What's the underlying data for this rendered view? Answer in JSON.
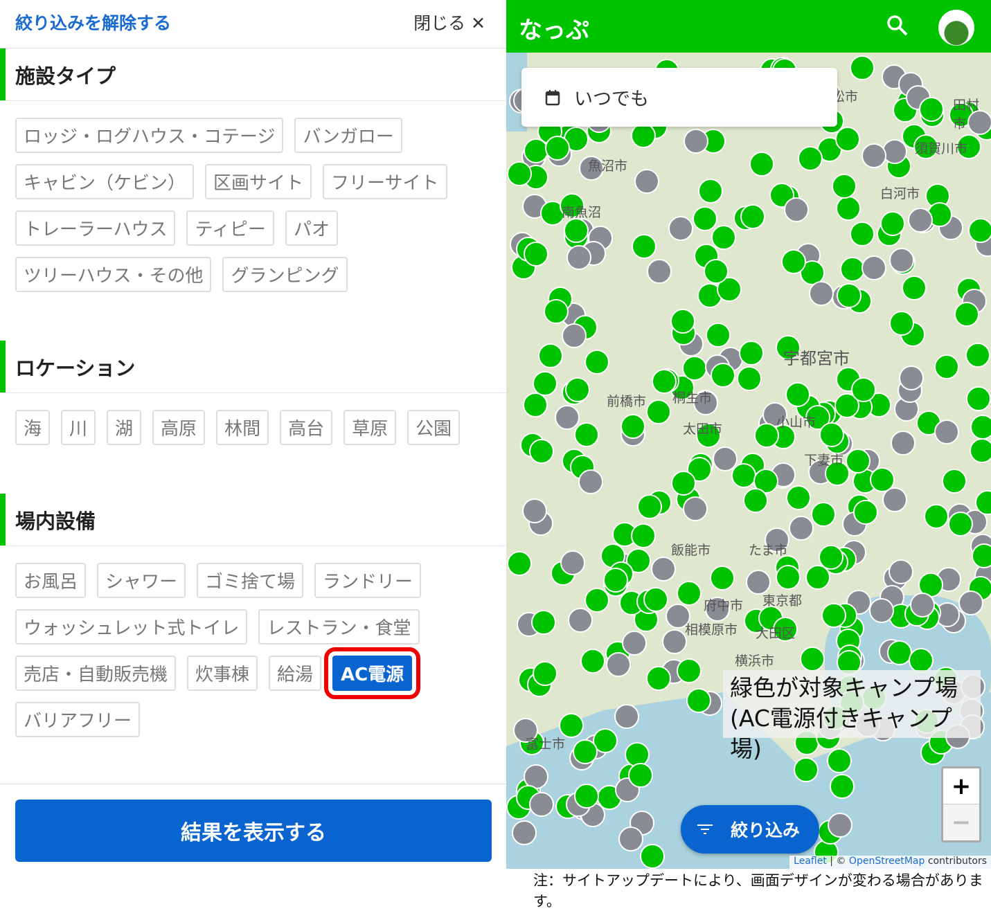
{
  "panel": {
    "clear_filter": "絞り込みを解除する",
    "close": "閉じる ✕",
    "sections": [
      {
        "title": "施設タイプ",
        "chips": [
          "ロッジ・ログハウス・コテージ",
          "バンガロー",
          "キャビン（ケビン）",
          "区画サイト",
          "フリーサイト",
          "トレーラーハウス",
          "ティピー",
          "パオ",
          "ツリーハウス・その他",
          "グランピング"
        ]
      },
      {
        "title": "ロケーション",
        "chips": [
          "海",
          "川",
          "湖",
          "高原",
          "林間",
          "高台",
          "草原",
          "公園"
        ]
      },
      {
        "title": "場内設備",
        "chips": [
          "お風呂",
          "シャワー",
          "ゴミ捨て場",
          "ランドリー",
          "ウォッシュレット式トイレ",
          "レストラン・食堂",
          "売店・自動販売機",
          "炊事棟",
          "給湯",
          "AC電源",
          "バリアフリー"
        ],
        "selected": "AC電源"
      }
    ],
    "show_results": "結果を表示する"
  },
  "map": {
    "app_title": "なっぷ",
    "date_filter": "いつでも",
    "filter_button": "絞り込み",
    "zoom_in": "+",
    "zoom_out": "−",
    "attribution_leaflet": "Leaflet",
    "attribution_rest": " | © ",
    "attribution_osm": "OpenStreetMap",
    "attribution_contrib": " contributors",
    "annotation_line1": "緑色が対象キャンプ場",
    "annotation_line2": "(AC電源付きキャンプ場)",
    "cities": [
      "魚沼市",
      "南魚沼",
      "宇都宮市",
      "前橋市",
      "桐生市",
      "太田市",
      "小山市",
      "下妻市",
      "飯能市",
      "たま市",
      "府中市",
      "東京都",
      "相模原市",
      "大田区",
      "横浜市",
      "富士市",
      "白河市",
      "須賀川市",
      "田村市",
      "松市"
    ],
    "colors": {
      "header": "#00c300",
      "match_marker": "#00c300",
      "other_marker": "#8a8c94",
      "accent": "#0a64d0"
    }
  },
  "footnote": "注：サイトアップデートにより、画面デザインが変わる場合があります。"
}
